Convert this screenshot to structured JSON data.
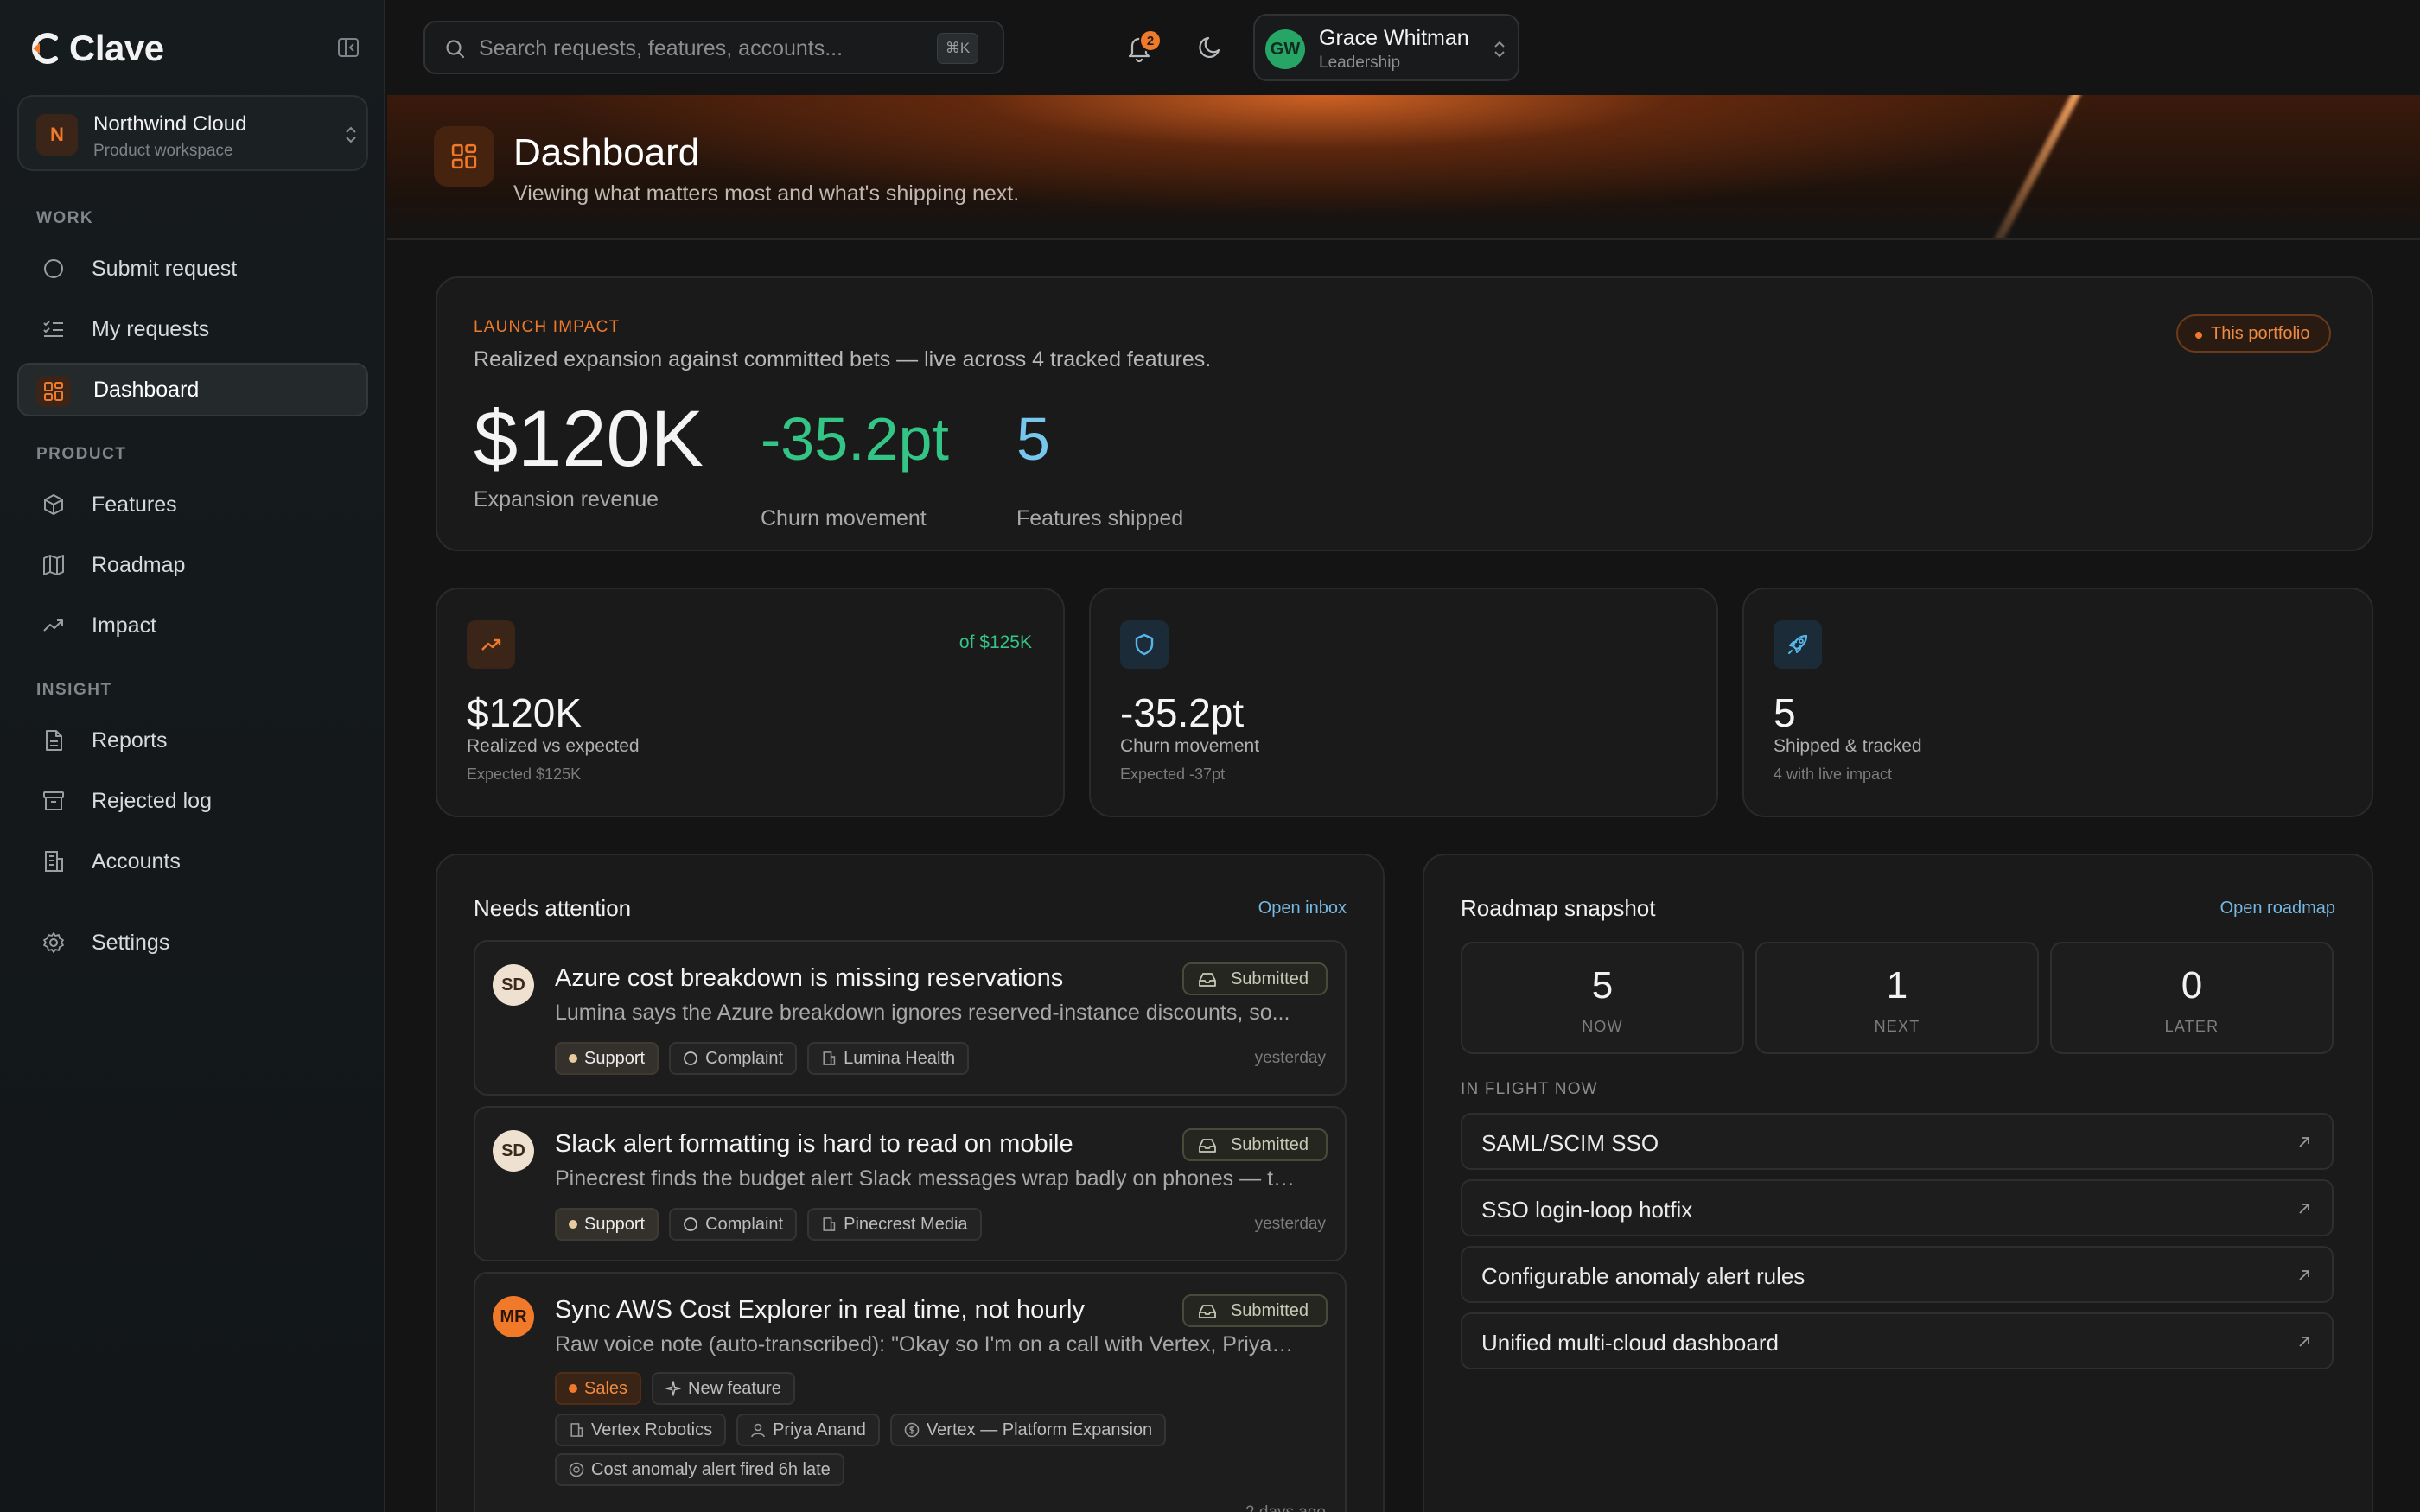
{
  "app": {
    "brand": "Clave",
    "workspace": {
      "initial": "N",
      "name": "Northwind Cloud",
      "subtitle": "Product workspace"
    }
  },
  "sidebar": {
    "sections": [
      {
        "title": "WORK"
      },
      {
        "title": "PRODUCT"
      },
      {
        "title": "INSIGHT"
      }
    ],
    "items": [
      {
        "label": "Submit request",
        "icon": "circle-icon"
      },
      {
        "label": "My requests",
        "icon": "list-check-icon"
      },
      {
        "label": "Dashboard",
        "icon": "dashboard-icon",
        "active": true
      },
      {
        "label": "Features",
        "icon": "cube-icon"
      },
      {
        "label": "Roadmap",
        "icon": "map-icon"
      },
      {
        "label": "Impact",
        "icon": "trend-icon"
      },
      {
        "label": "Reports",
        "icon": "document-icon"
      },
      {
        "label": "Rejected log",
        "icon": "archive-icon"
      },
      {
        "label": "Accounts",
        "icon": "building-icon"
      },
      {
        "label": "Settings",
        "icon": "gear-icon"
      }
    ]
  },
  "topbar": {
    "search_placeholder": "Search requests, features, accounts...",
    "search_shortcut": "⌘K",
    "notifications_count": "2",
    "user": {
      "initials": "GW",
      "name": "Grace Whitman",
      "role": "Leadership"
    }
  },
  "hero": {
    "title": "Dashboard",
    "subtitle": "Viewing what matters most and what's shipping next."
  },
  "launch_impact": {
    "eyebrow": "LAUNCH IMPACT",
    "description": "Realized expansion against committed bets — live across 4 tracked features.",
    "badge": "This portfolio",
    "stats": [
      {
        "value": "$120K",
        "label": "Expansion revenue",
        "color": "#f4f4f4"
      },
      {
        "value": "-35.2pt",
        "label": "Churn movement",
        "color": "#34c586"
      },
      {
        "value": "5",
        "label": "Features shipped",
        "color": "#76c6ee"
      }
    ]
  },
  "metrics": [
    {
      "icon": "trend-up-icon",
      "target": "of $125K",
      "value": "$120K",
      "label": "Realized vs expected",
      "sub": "Expected $125K",
      "accent": "#f07a2a"
    },
    {
      "icon": "shield-icon",
      "target": "",
      "value": "-35.2pt",
      "label": "Churn movement",
      "sub": "Expected -37pt",
      "accent": "#58b5e8"
    },
    {
      "icon": "rocket-icon",
      "target": "",
      "value": "5",
      "label": "Shipped & tracked",
      "sub": "4 with live impact",
      "accent": "#58b5e8"
    }
  ],
  "attention": {
    "title": "Needs attention",
    "link": "Open inbox",
    "requests": [
      {
        "initials": "SD",
        "title": "Azure cost breakdown is missing reservations",
        "description": "Lumina says the Azure breakdown ignores reserved-instance discounts, so...",
        "status": "Submitted",
        "tags": [
          "Support",
          "Complaint",
          "Lumina Health"
        ],
        "when": "yesterday"
      },
      {
        "initials": "SD",
        "title": "Slack alert formatting is hard to read on mobile",
        "description": "Pinecrest finds the budget alert Slack messages wrap badly on phones — the...",
        "status": "Submitted",
        "tags": [
          "Support",
          "Complaint",
          "Pinecrest Media"
        ],
        "when": "yesterday"
      },
      {
        "initials": "MR",
        "title": "Sync AWS Cost Explorer in real time, not hourly",
        "description": "Raw voice note (auto-transcribed): \"Okay so I'm on a call with Vertex, Priya thei...",
        "status": "Submitted",
        "tags": [
          "Sales",
          "New feature"
        ],
        "extra_tags": [
          "Vertex Robotics",
          "Priya Anand",
          "Vertex — Platform Expansion"
        ],
        "extra_tags_2": [
          "Cost anomaly alert fired 6h late"
        ],
        "when": "2 days ago"
      }
    ]
  },
  "roadmap": {
    "title": "Roadmap snapshot",
    "link": "Open roadmap",
    "columns": [
      {
        "count": "5",
        "label": "NOW"
      },
      {
        "count": "1",
        "label": "NEXT"
      },
      {
        "count": "0",
        "label": "LATER"
      }
    ],
    "inflight_title": "IN FLIGHT NOW",
    "inflight": [
      "SAML/SCIM SSO",
      "SSO login-loop hotfix",
      "Configurable anomaly alert rules",
      "Unified multi-cloud dashboard"
    ]
  }
}
